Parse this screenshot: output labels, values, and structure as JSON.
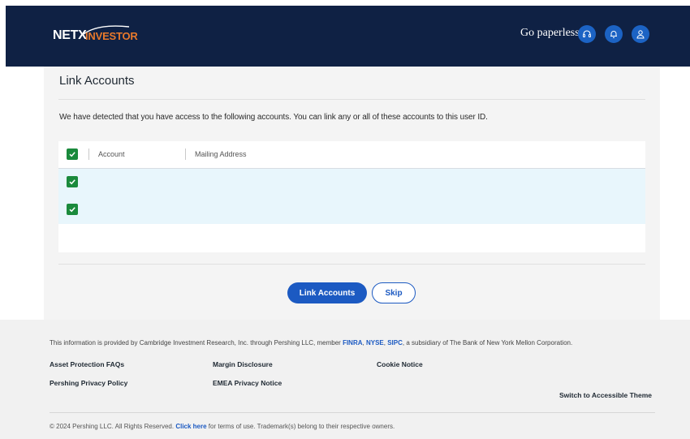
{
  "header": {
    "logo_netx": "NETX",
    "logo_investor": "INVESTOR",
    "go_paperless": "Go paperless",
    "icons": [
      "support-icon",
      "bell-icon",
      "user-icon"
    ]
  },
  "main": {
    "title": "Link Accounts",
    "description": "We have detected that you have access to the following accounts. You can link any or all of these accounts to this user ID.",
    "table": {
      "columns": [
        "Account",
        "Mailing Address"
      ],
      "rows": [
        {
          "checked": true,
          "account": "",
          "mailing_address": ""
        },
        {
          "checked": true,
          "account": "",
          "mailing_address": ""
        }
      ]
    },
    "buttons": {
      "link_accounts": "Link Accounts",
      "skip": "Skip"
    }
  },
  "footer": {
    "info_prefix": "This information is provided by Cambridge Investment Research, Inc. through Pershing LLC, member ",
    "info_finra": "FINRA",
    "info_sep1": ", ",
    "info_nyse": "NYSE",
    "info_sep2": ", ",
    "info_sipc": "SIPC",
    "info_suffix": ", a subsidiary of The Bank of New York Mellon Corporation.",
    "links": {
      "asset_protection": "Asset Protection FAQs",
      "margin_disclosure": "Margin Disclosure",
      "cookie_notice": "Cookie Notice",
      "pershing_privacy": "Pershing Privacy Policy",
      "emea_privacy": "EMEA Privacy Notice",
      "accessible_theme": "Switch to Accessible Theme"
    },
    "copyright_prefix": "© 2024 Pershing LLC. All Rights Reserved. ",
    "copyright_link": "Click here",
    "copyright_suffix": " for terms of use. Trademark(s) belong to their respective owners."
  },
  "colors": {
    "header_bg": "#0f2144",
    "accent_blue": "#1c5ac2",
    "check_green": "#1a8a3c",
    "row_highlight": "#e8f6fc",
    "logo_orange": "#e8792b"
  }
}
